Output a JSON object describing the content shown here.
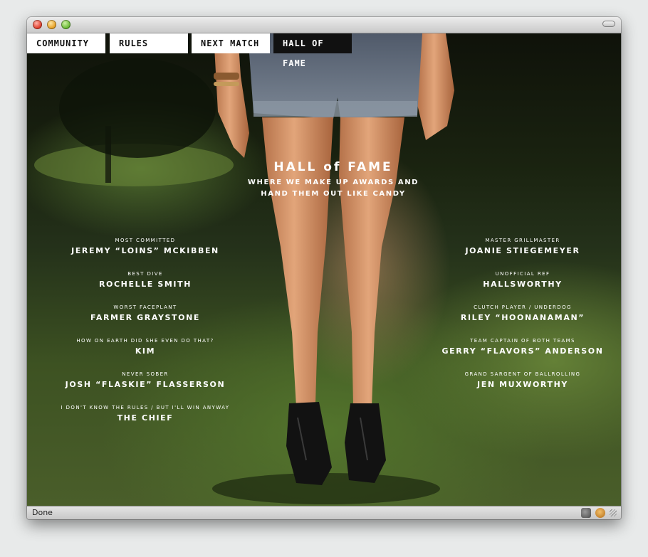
{
  "status": {
    "text": "Done"
  },
  "nav": {
    "tabs": [
      {
        "label": "COMMUNITY"
      },
      {
        "label": "RULES"
      },
      {
        "label": "NEXT MATCH"
      },
      {
        "label": "HALL OF FAME",
        "active": true
      }
    ]
  },
  "hero": {
    "title": "HALL of FAME",
    "subtitle": "WHERE WE MAKE UP AWARDS AND\nHAND THEM OUT LIKE CANDY"
  },
  "awards_left": [
    {
      "title": "MOST COMMITTED",
      "name": "JEREMY “LOINS” MCKIBBEN"
    },
    {
      "title": "BEST DIVE",
      "name": "ROCHELLE SMITH"
    },
    {
      "title": "WORST FACEPLANT",
      "name": "FARMER GRAYSTONE"
    },
    {
      "title": "HOW ON EARTH DID SHE EVEN DO THAT?",
      "name": "KIM"
    },
    {
      "title": "NEVER SOBER",
      "name": "JOSH “FLASKIE” FLASSERSON"
    },
    {
      "title": "I DON'T KNOW THE RULES / BUT I'LL WIN ANYWAY",
      "name": "THE CHIEF"
    }
  ],
  "awards_right": [
    {
      "title": "MASTER GRILLMASTER",
      "name": "JOANIE STIEGEMEYER"
    },
    {
      "title": "UNOFFICIAL REF",
      "name": "HALLSWORTHY"
    },
    {
      "title": "CLUTCH PLAYER / UNDERDOG",
      "name": "RILEY “HOONANAMAN”"
    },
    {
      "title": "TEAM CAPTAIN OF BOTH TEAMS",
      "name": "GERRY “FLAVORS” ANDERSON"
    },
    {
      "title": "GRAND SARGENT OF BALLROLLING",
      "name": "JEN MUXWORTHY"
    }
  ],
  "icons": {
    "close": "close-circle-icon",
    "minimize": "minimize-circle-icon",
    "maximize": "maximize-circle-icon",
    "toolbar_toggle": "toolbar-pill-icon",
    "plugin": "plugin-icon",
    "monkey": "greasemonkey-icon",
    "resize": "resize-grip-icon"
  },
  "colors": {
    "nav_bg": "#ffffff",
    "nav_active_bg": "#111111",
    "text_light": "#ffffff"
  }
}
